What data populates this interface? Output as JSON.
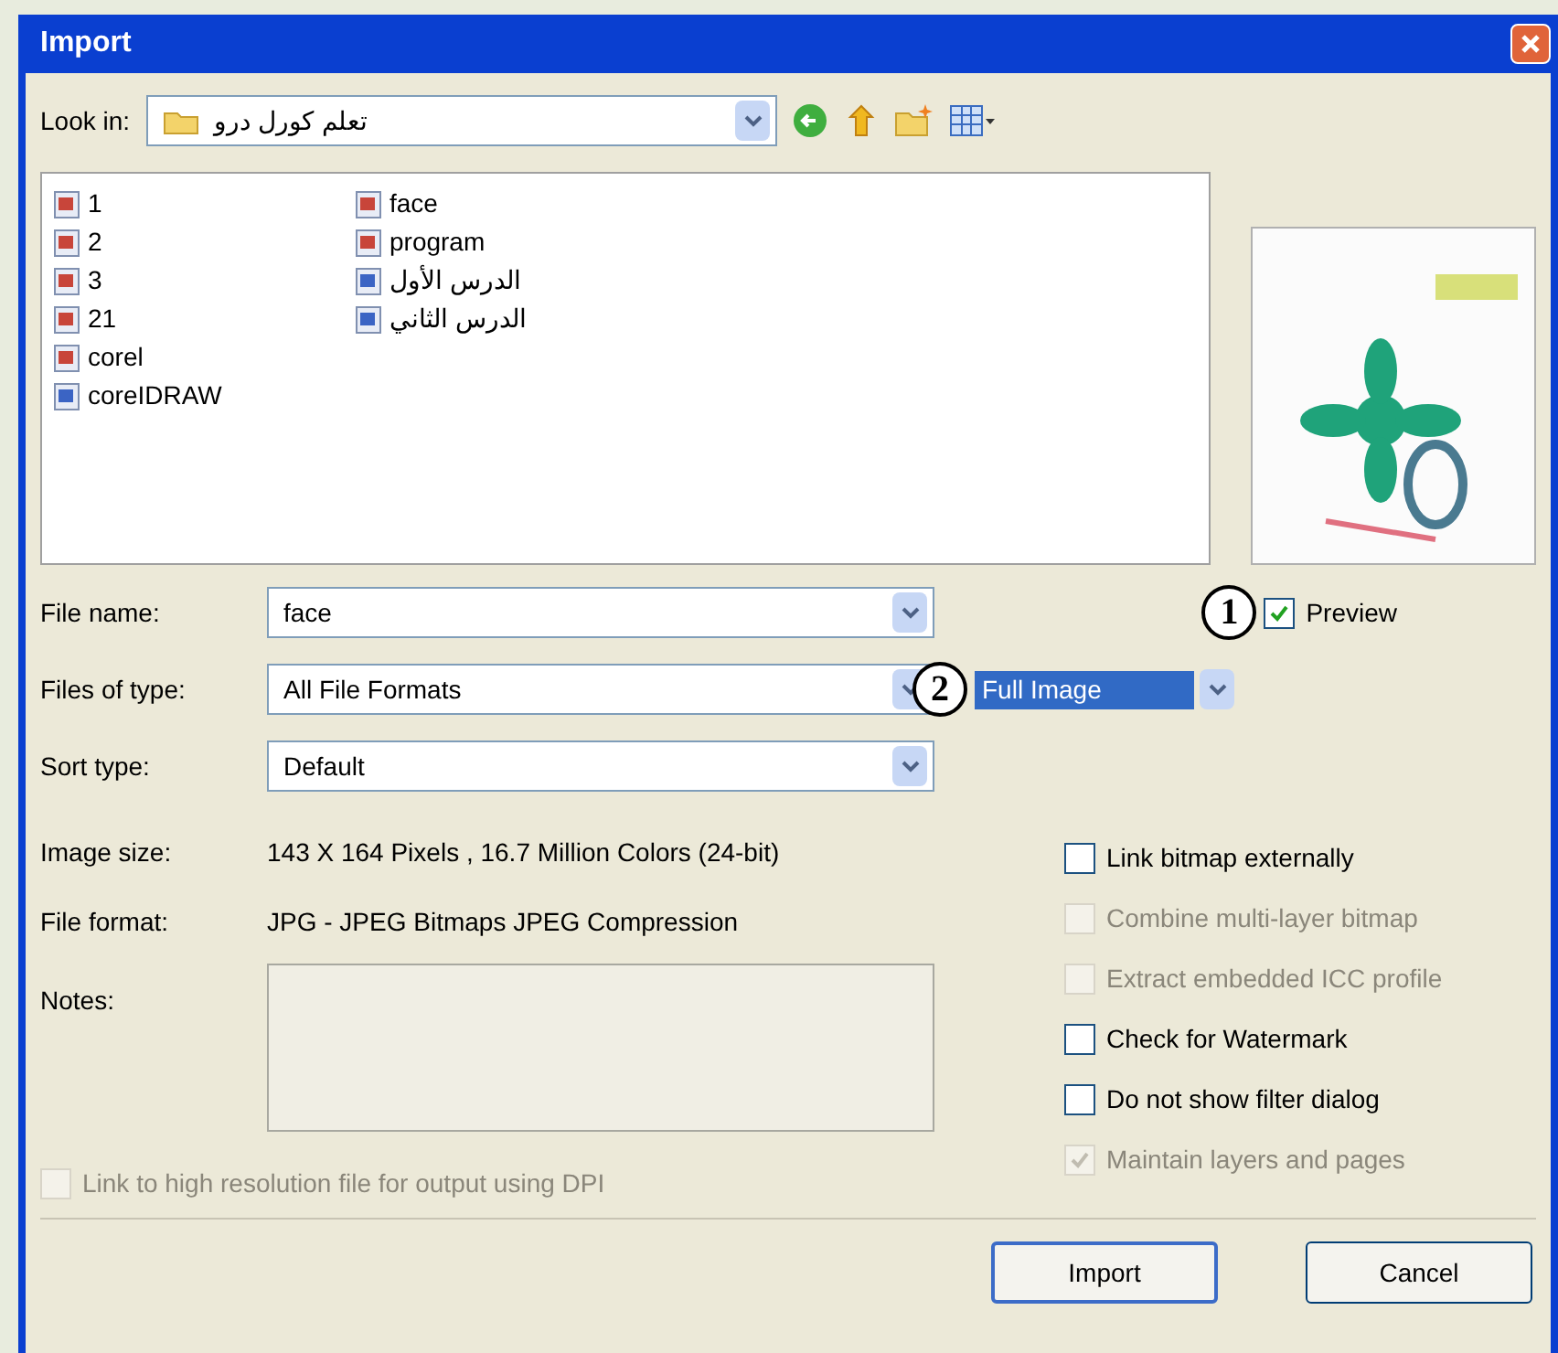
{
  "window": {
    "title": "Import"
  },
  "look_in": {
    "label": "Look in:",
    "value": "تعلم كورل درو"
  },
  "files": [
    [
      {
        "name": "1",
        "kind": "bitmap"
      },
      {
        "name": "2",
        "kind": "bitmap"
      },
      {
        "name": "3",
        "kind": "bitmap"
      },
      {
        "name": "21",
        "kind": "bitmap"
      },
      {
        "name": "corel",
        "kind": "bitmap"
      },
      {
        "name": "coreIDRAW",
        "kind": "vector"
      }
    ],
    [
      {
        "name": "face",
        "kind": "bitmap"
      },
      {
        "name": "program",
        "kind": "bitmap"
      },
      {
        "name": "الدرس الأول",
        "kind": "vector"
      },
      {
        "name": "الدرس الثاني",
        "kind": "vector"
      }
    ]
  ],
  "file_name": {
    "label": "File name:",
    "value": "face"
  },
  "files_of_type": {
    "label": "Files of type:",
    "value": "All File Formats"
  },
  "sort_type": {
    "label": "Sort type:",
    "value": "Default"
  },
  "image_mode": {
    "value": "Full Image"
  },
  "preview": {
    "label": "Preview",
    "checked": true
  },
  "callouts": [
    "1",
    "2"
  ],
  "info": [
    {
      "label": "Image size:",
      "value": "143 X 164 Pixels , 16.7 Million Colors (24-bit)"
    },
    {
      "label": "File format:",
      "value": "JPG - JPEG Bitmaps JPEG Compression"
    }
  ],
  "notes": {
    "label": "Notes:"
  },
  "options": [
    {
      "label": "Link bitmap externally",
      "checked": false,
      "disabled": false
    },
    {
      "label": "Combine multi-layer bitmap",
      "checked": false,
      "disabled": true
    },
    {
      "label": "Extract embedded ICC profile",
      "checked": false,
      "disabled": true
    },
    {
      "label": "Check for Watermark",
      "checked": false,
      "disabled": false
    },
    {
      "label": "Do not show filter dialog",
      "checked": false,
      "disabled": false
    },
    {
      "label": "Maintain layers and pages",
      "checked": true,
      "disabled": true
    }
  ],
  "high_res": {
    "label": "Link to high resolution file for output using DPI",
    "checked": false,
    "disabled": true
  },
  "buttons": [
    "Import",
    "Cancel"
  ]
}
